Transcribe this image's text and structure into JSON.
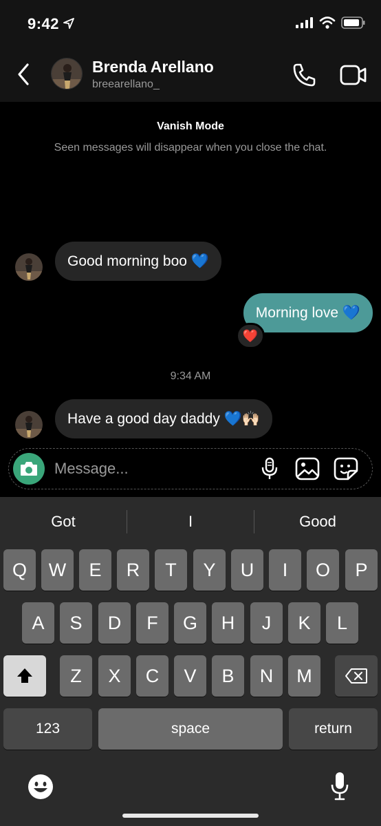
{
  "status_bar": {
    "time": "9:42",
    "icons": [
      "location-arrow-icon",
      "signal-icon",
      "wifi-icon",
      "battery-icon"
    ]
  },
  "header": {
    "name": "Brenda Arellano",
    "handle": "breearellano_",
    "icons": [
      "back-icon",
      "phone-icon",
      "video-camera-icon"
    ]
  },
  "vanish": {
    "title": "Vanish Mode",
    "subtitle": "Seen messages will disappear when you close the chat."
  },
  "messages": [
    {
      "direction": "in",
      "text": "Good morning boo 💙"
    },
    {
      "direction": "out",
      "text": "Morning love 💙",
      "reaction": "❤️"
    },
    {
      "direction": "in",
      "text": "Have a good day daddy 💙🙌🏻"
    }
  ],
  "timestamp": "9:34 AM",
  "composer": {
    "placeholder": "Message...",
    "icons": [
      "camera-icon",
      "microphone-icon",
      "gallery-icon",
      "sticker-icon"
    ]
  },
  "keyboard": {
    "suggestions": [
      "Got",
      "I",
      "Good"
    ],
    "row1": [
      "Q",
      "W",
      "E",
      "R",
      "T",
      "Y",
      "U",
      "I",
      "O",
      "P"
    ],
    "row2": [
      "A",
      "S",
      "D",
      "F",
      "G",
      "H",
      "J",
      "K",
      "L"
    ],
    "row3": [
      "Z",
      "X",
      "C",
      "V",
      "B",
      "N",
      "M"
    ],
    "numbers_key": "123",
    "space_key": "space",
    "return_key": "return"
  },
  "colors": {
    "outgoing_bubble": "#4d9a98",
    "incoming_bubble": "#262626",
    "camera_button": "#3aa67a",
    "heart_blue": "#2f7bff"
  }
}
